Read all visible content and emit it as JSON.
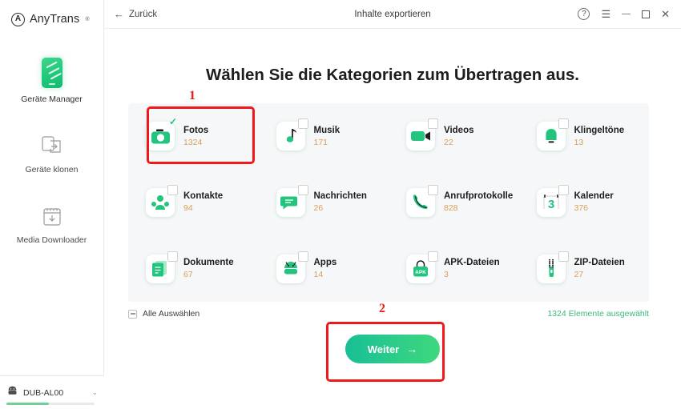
{
  "app": {
    "brand_mark": "A",
    "brand_name": "AnyTrans",
    "brand_reg": "®"
  },
  "sidebar": {
    "items": [
      {
        "label": "Geräte Manager",
        "icon": "phone-icon",
        "active": true
      },
      {
        "label": "Geräte klonen",
        "icon": "clone-icon",
        "active": false
      },
      {
        "label": "Media Downloader",
        "icon": "download-icon",
        "active": false
      }
    ],
    "device": {
      "name": "DUB-AL00",
      "icon": "android-icon",
      "chevron": "⌄",
      "storage_percent": 48
    }
  },
  "titlebar": {
    "back_arrow": "←",
    "back_label": "Zurück",
    "title": "Inhalte exportieren",
    "help_icon": "?",
    "menu_icon": "☰",
    "minimize_icon": "minimize-icon",
    "maximize_icon": "maximize-icon",
    "close_icon": "✕"
  },
  "main": {
    "heading": "Wählen Sie die Kategorien zum Übertragen aus.",
    "categories": [
      {
        "name": "Fotos",
        "count": "1324",
        "icon": "camera-icon",
        "checked": true
      },
      {
        "name": "Musik",
        "count": "171",
        "icon": "music-icon",
        "checked": false
      },
      {
        "name": "Videos",
        "count": "22",
        "icon": "video-icon",
        "checked": false
      },
      {
        "name": "Klingeltöne",
        "count": "13",
        "icon": "bell-icon",
        "checked": false
      },
      {
        "name": "Kontakte",
        "count": "94",
        "icon": "contacts-icon",
        "checked": false
      },
      {
        "name": "Nachrichten",
        "count": "26",
        "icon": "message-icon",
        "checked": false
      },
      {
        "name": "Anrufprotokolle",
        "count": "828",
        "icon": "phonecall-icon",
        "checked": false
      },
      {
        "name": "Kalender",
        "count": "376",
        "icon": "calendar-icon",
        "checked": false
      },
      {
        "name": "Dokumente",
        "count": "67",
        "icon": "document-icon",
        "checked": false
      },
      {
        "name": "Apps",
        "count": "14",
        "icon": "android-icon",
        "checked": false
      },
      {
        "name": "APK-Dateien",
        "count": "3",
        "icon": "apk-icon",
        "checked": false
      },
      {
        "name": "ZIP-Dateien",
        "count": "27",
        "icon": "zip-icon",
        "checked": false
      }
    ],
    "calendar_day": "3",
    "apk_label": "APK",
    "select_all_label": "Alle Auswählen",
    "selected_count_text": "1324 Elemente ausgewählt",
    "next_label": "Weiter",
    "next_arrow": "→"
  },
  "annotations": {
    "step_1": "1",
    "step_2": "2"
  },
  "colors": {
    "accent_green": "#25c281",
    "count_orange": "#d8a05a",
    "annotation_red": "#f01818",
    "panel_bg": "#f6f7f8"
  }
}
